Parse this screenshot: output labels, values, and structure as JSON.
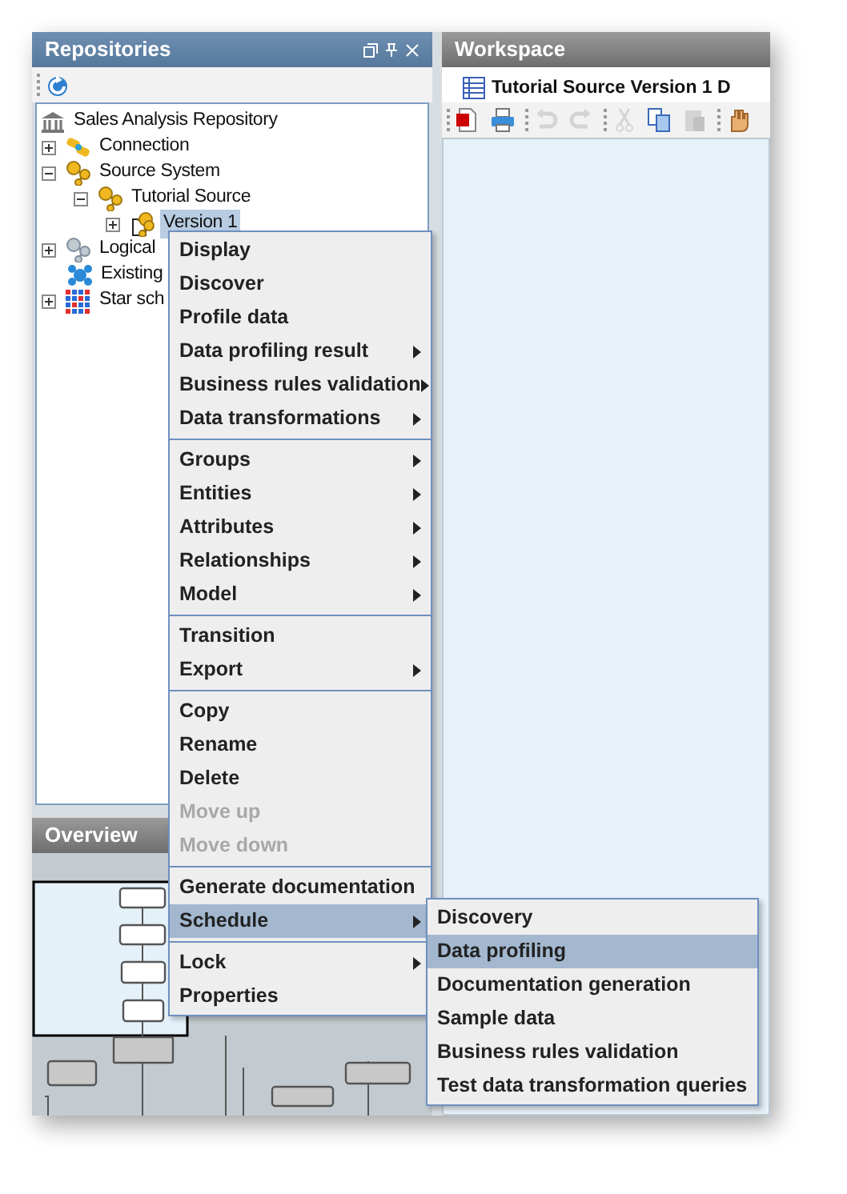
{
  "repositories_panel": {
    "title": "Repositories",
    "tree": [
      {
        "label": "Sales Analysis Repository",
        "kind": "repository",
        "children": [
          {
            "label": "Connection",
            "kind": "connection",
            "expanded": false
          },
          {
            "label": "Source System",
            "kind": "system",
            "expanded": true,
            "children": [
              {
                "label": "Tutorial Source",
                "kind": "system",
                "expanded": true,
                "children": [
                  {
                    "label": "Version 1",
                    "kind": "version",
                    "expanded": false,
                    "selected": true
                  }
                ]
              }
            ]
          },
          {
            "label": "Logical",
            "kind": "logical",
            "expanded": false
          },
          {
            "label": "Existing",
            "kind": "existing"
          },
          {
            "label": "Star sch",
            "kind": "star",
            "expanded": false
          }
        ]
      }
    ]
  },
  "overview_panel": {
    "title": "Overview"
  },
  "workspace": {
    "title": "Workspace",
    "tab": "Tutorial Source Version 1 D",
    "toolbar": [
      {
        "kind": "pdf",
        "disabled": false
      },
      {
        "kind": "print",
        "disabled": false
      },
      {
        "kind": "sep"
      },
      {
        "kind": "undo",
        "disabled": true
      },
      {
        "kind": "redo",
        "disabled": true
      },
      {
        "kind": "sep"
      },
      {
        "kind": "cut",
        "disabled": true
      },
      {
        "kind": "copy",
        "disabled": false
      },
      {
        "kind": "paste",
        "disabled": true
      },
      {
        "kind": "sep"
      },
      {
        "kind": "hand",
        "disabled": false
      }
    ]
  },
  "context_menu": [
    [
      {
        "label": "Display",
        "submenu": false,
        "disabled": false,
        "selected": false
      },
      {
        "label": "Discover",
        "submenu": false,
        "disabled": false,
        "selected": false
      },
      {
        "label": "Profile data",
        "submenu": false,
        "disabled": false,
        "selected": false
      },
      {
        "label": "Data profiling result",
        "submenu": true,
        "disabled": false,
        "selected": false
      },
      {
        "label": "Business rules validation",
        "submenu": true,
        "disabled": false,
        "selected": false
      },
      {
        "label": "Data transformations",
        "submenu": true,
        "disabled": false,
        "selected": false
      }
    ],
    [
      {
        "label": "Groups",
        "submenu": true,
        "disabled": false,
        "selected": false
      },
      {
        "label": "Entities",
        "submenu": true,
        "disabled": false,
        "selected": false
      },
      {
        "label": "Attributes",
        "submenu": true,
        "disabled": false,
        "selected": false
      },
      {
        "label": "Relationships",
        "submenu": true,
        "disabled": false,
        "selected": false
      },
      {
        "label": "Model",
        "submenu": true,
        "disabled": false,
        "selected": false
      }
    ],
    [
      {
        "label": "Transition",
        "submenu": false,
        "disabled": false,
        "selected": false
      },
      {
        "label": "Export",
        "submenu": true,
        "disabled": false,
        "selected": false
      }
    ],
    [
      {
        "label": "Copy",
        "submenu": false,
        "disabled": false,
        "selected": false
      },
      {
        "label": "Rename",
        "submenu": false,
        "disabled": false,
        "selected": false
      },
      {
        "label": "Delete",
        "submenu": false,
        "disabled": false,
        "selected": false
      },
      {
        "label": "Move up",
        "submenu": false,
        "disabled": true,
        "selected": false
      },
      {
        "label": "Move down",
        "submenu": false,
        "disabled": true,
        "selected": false
      }
    ],
    [
      {
        "label": "Generate documentation",
        "submenu": false,
        "disabled": false,
        "selected": false
      },
      {
        "label": "Schedule",
        "submenu": true,
        "disabled": false,
        "selected": true
      }
    ],
    [
      {
        "label": "Lock",
        "submenu": true,
        "disabled": false,
        "selected": false
      },
      {
        "label": "Properties",
        "submenu": false,
        "disabled": false,
        "selected": false
      }
    ]
  ],
  "schedule_submenu": [
    {
      "label": "Discovery",
      "selected": false
    },
    {
      "label": "Data profiling",
      "selected": true
    },
    {
      "label": "Documentation generation",
      "selected": false
    },
    {
      "label": "Sample data",
      "selected": false
    },
    {
      "label": "Business rules validation",
      "selected": false
    },
    {
      "label": "Test data transformation queries",
      "selected": false
    }
  ]
}
